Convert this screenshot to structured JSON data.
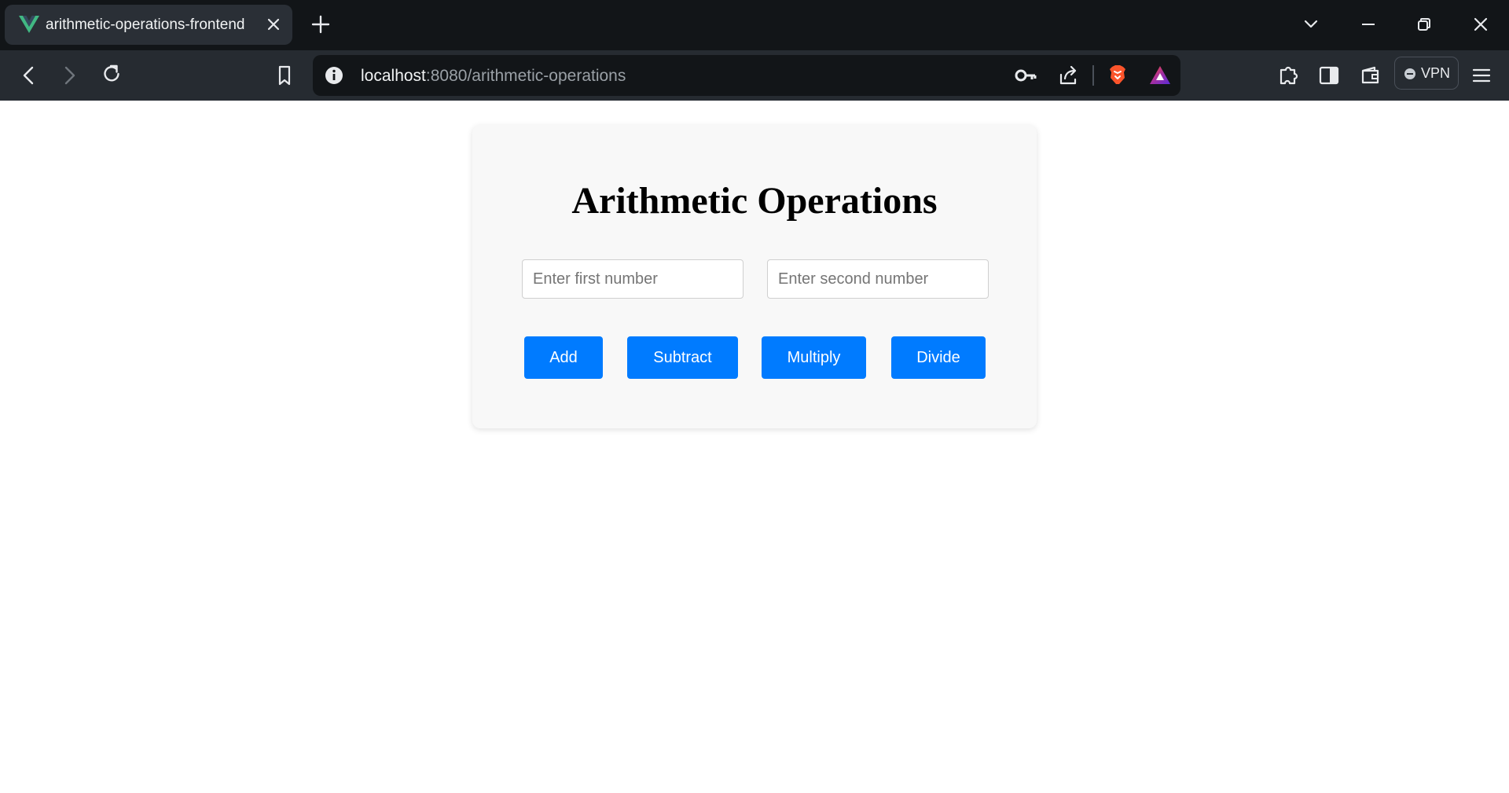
{
  "browser": {
    "tab": {
      "title": "arithmetic-operations-frontend",
      "favicon": "vue-logo-icon"
    },
    "url": {
      "host": "localhost",
      "rest": ":8080/arithmetic-operations"
    },
    "vpn_label": "VPN"
  },
  "page": {
    "title": "Arithmetic Operations",
    "inputs": {
      "first_placeholder": "Enter first number",
      "first_value": "",
      "second_placeholder": "Enter second number",
      "second_value": ""
    },
    "buttons": {
      "add": "Add",
      "subtract": "Subtract",
      "multiply": "Multiply",
      "divide": "Divide"
    }
  },
  "colors": {
    "accent": "#007bff",
    "card_bg": "#f8f8f8",
    "chrome_dark": "#121518",
    "toolbar": "#262b31"
  }
}
